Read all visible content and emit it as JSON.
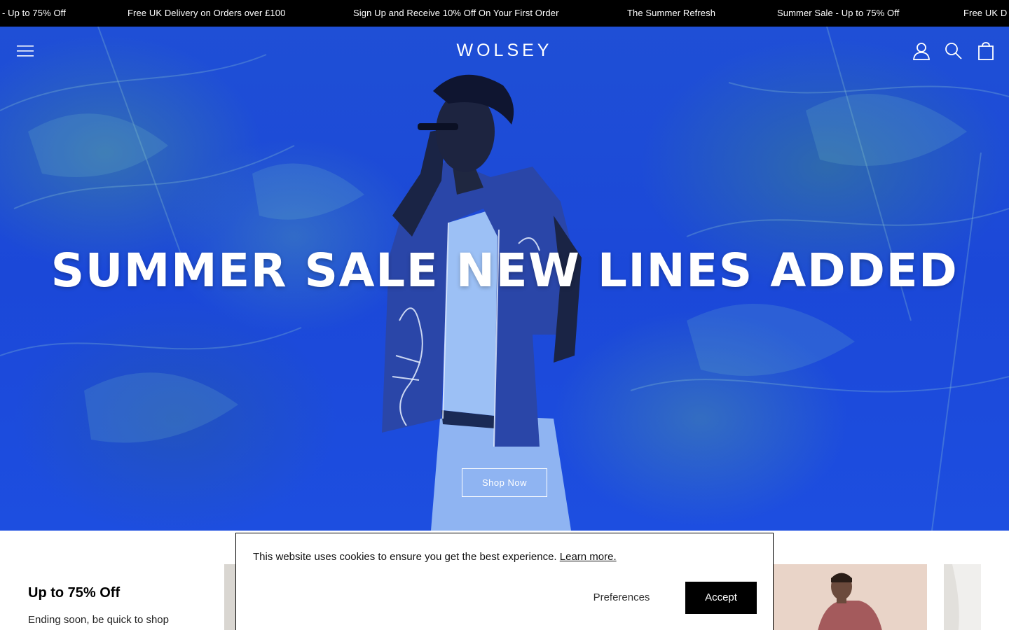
{
  "announcement_bar": {
    "items": [
      "- Up to 75% Off",
      "Free UK Delivery on Orders over £100",
      "Sign Up and Receive 10% Off On Your First Order",
      "The Summer Refresh",
      "Summer Sale - Up to 75% Off",
      "Free UK D"
    ]
  },
  "header": {
    "logo": "WOLSEY",
    "icons": [
      "menu-icon",
      "account-icon",
      "search-icon",
      "bag-icon"
    ]
  },
  "hero": {
    "title": "SUMMER SALE NEW LINES ADDED",
    "cta_label": "Shop Now"
  },
  "promo": {
    "title": "Up to 75% Off",
    "subtitle": "Ending soon, be quick to shop"
  },
  "cookie_banner": {
    "message": "This website uses cookies to ensure you get the best experience.",
    "link_label": "Learn more.",
    "preferences_label": "Preferences",
    "accept_label": "Accept"
  },
  "colors": {
    "hero_overlay": "#1d4ee0",
    "announcement_bg": "#000000",
    "accept_bg": "#000000"
  }
}
